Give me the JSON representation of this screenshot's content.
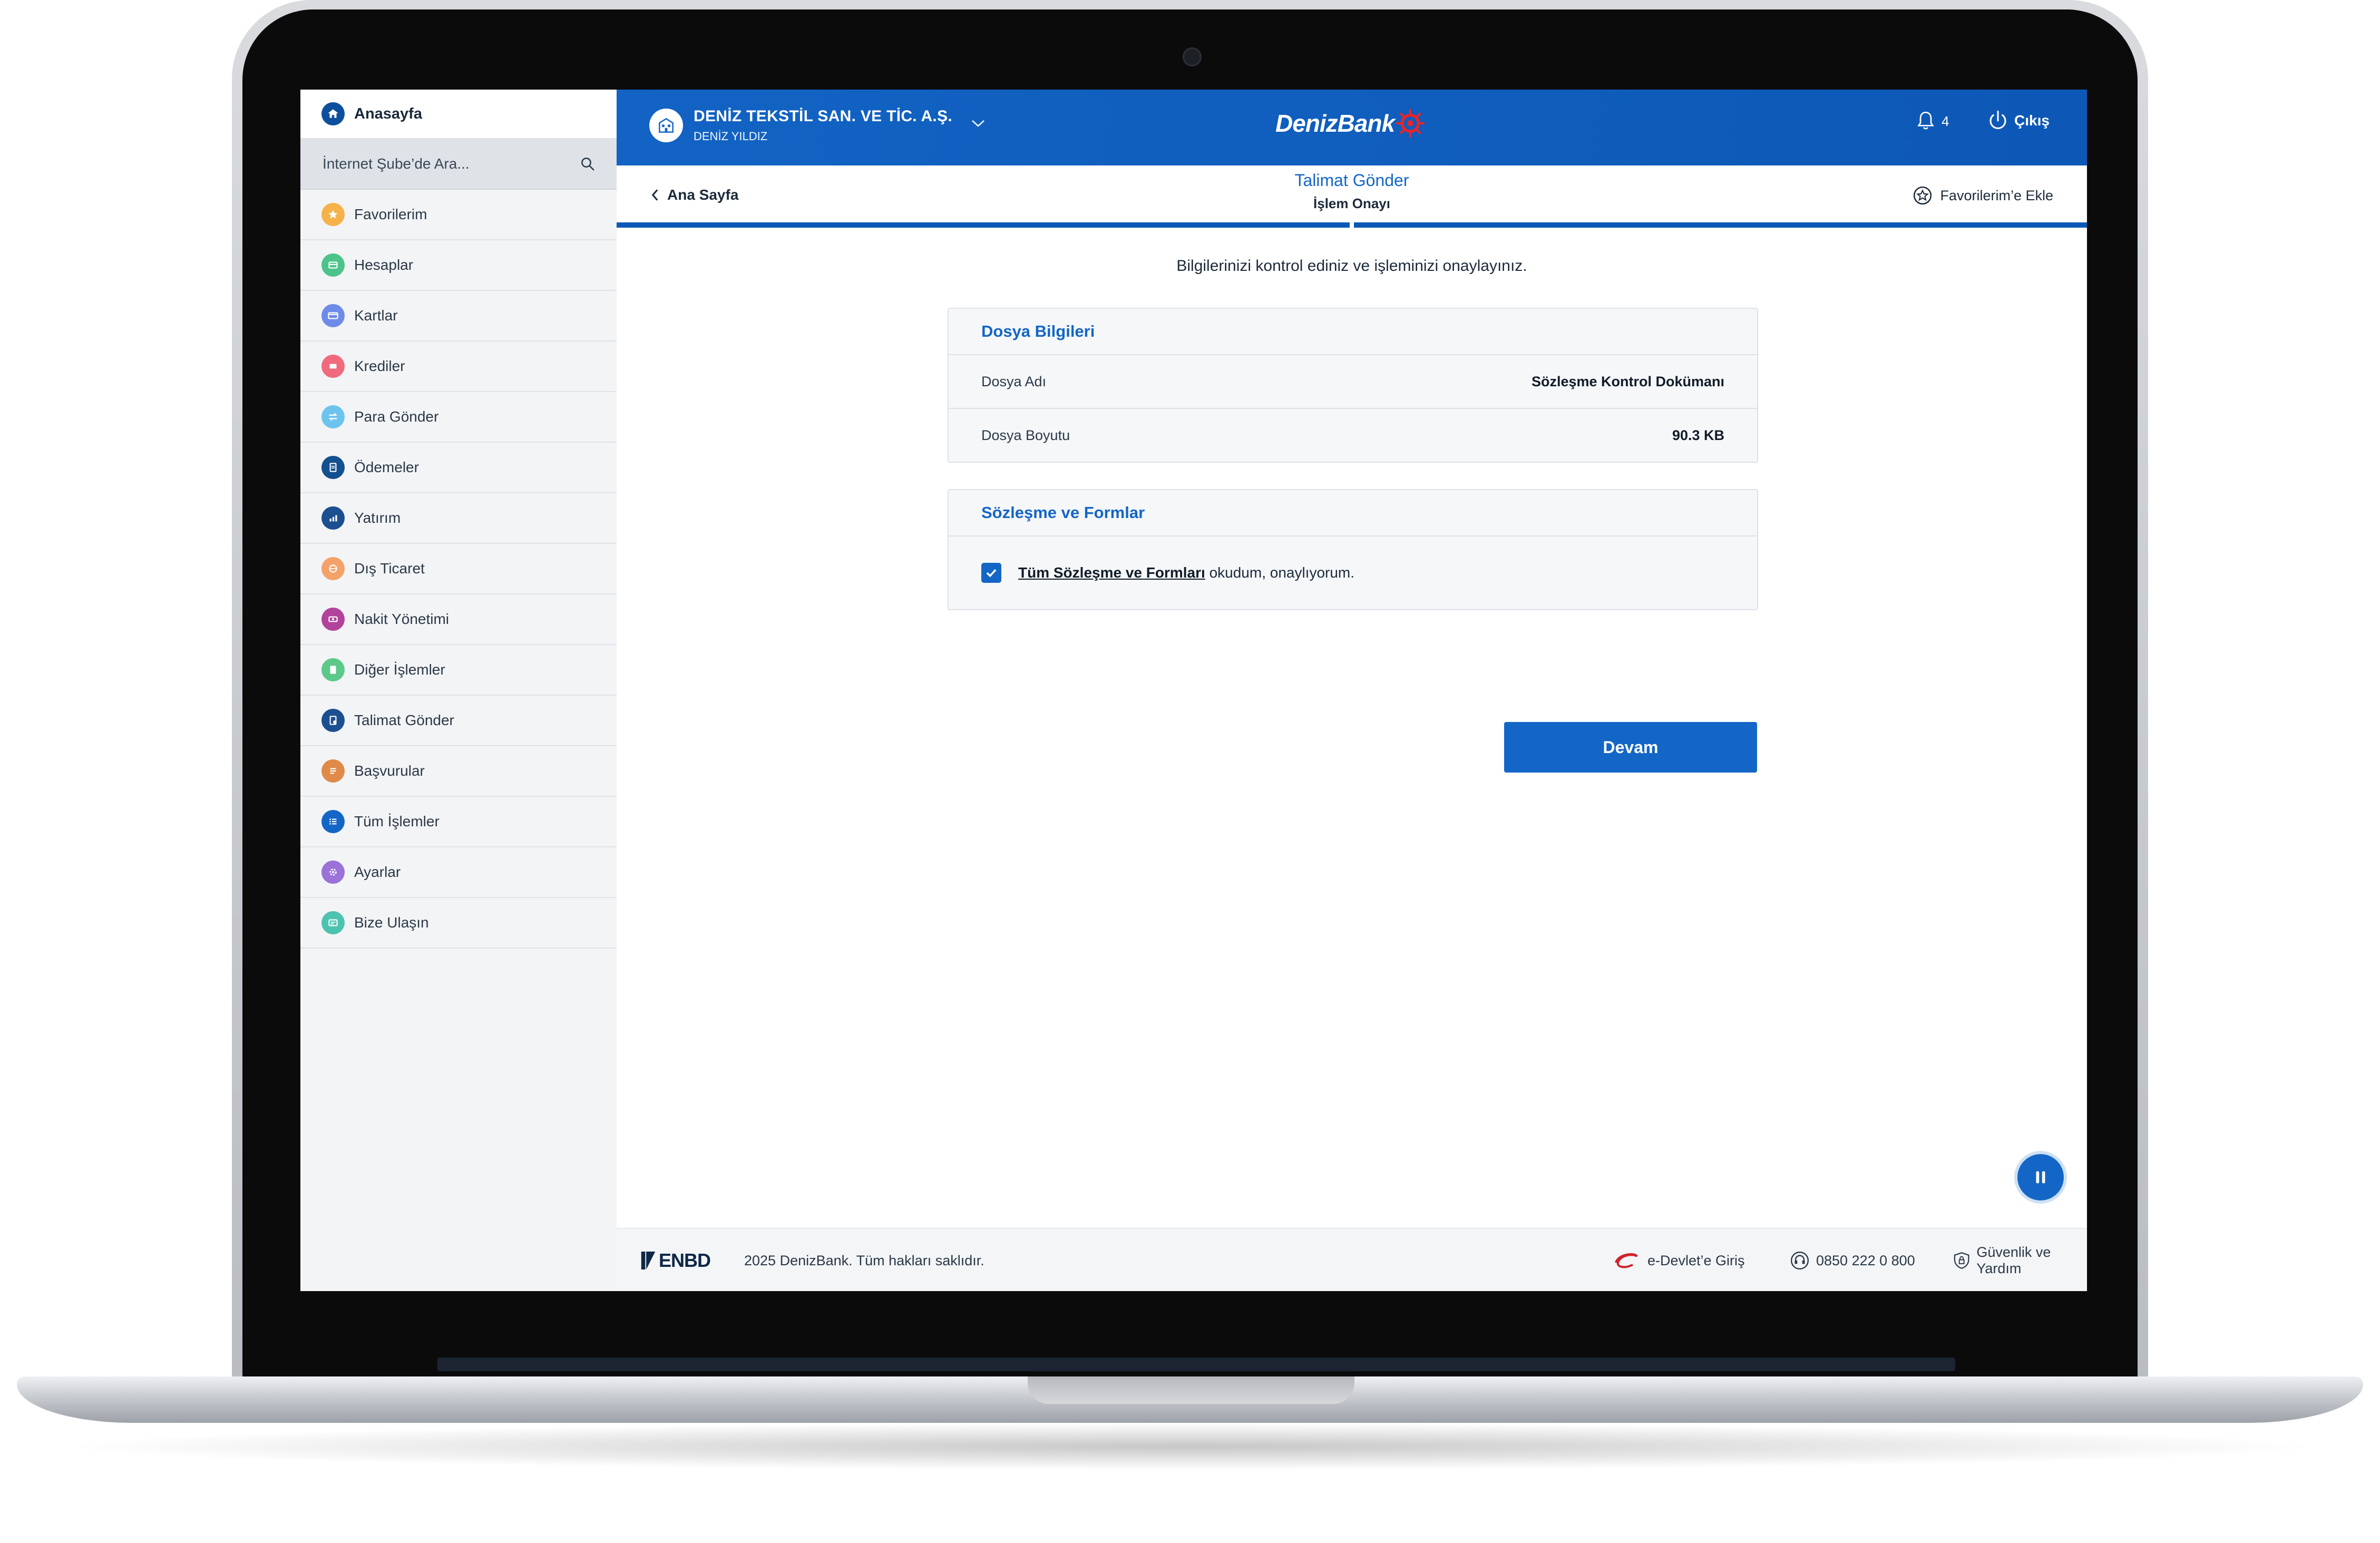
{
  "sidebar": {
    "home_label": "Anasayfa",
    "search_placeholder": "İnternet Şube’de Ara...",
    "items": [
      {
        "label": "Favorilerim",
        "icon": "star-icon",
        "color": "#f6b24a"
      },
      {
        "label": "Hesaplar",
        "icon": "accounts-icon",
        "color": "#4cc38a"
      },
      {
        "label": "Kartlar",
        "icon": "card-icon",
        "color": "#6d8be8"
      },
      {
        "label": "Krediler",
        "icon": "loan-icon",
        "color": "#f06a7e"
      },
      {
        "label": "Para Gönder",
        "icon": "transfer-icon",
        "color": "#6cc4ee"
      },
      {
        "label": "Ödemeler",
        "icon": "payments-icon",
        "color": "#12508f"
      },
      {
        "label": "Yatırım",
        "icon": "investment-icon",
        "color": "#1b4f8f"
      },
      {
        "label": "Dış Ticaret",
        "icon": "trade-icon",
        "color": "#f4a26a"
      },
      {
        "label": "Nakit Yönetimi",
        "icon": "cash-icon",
        "color": "#b2439a"
      },
      {
        "label": "Diğer İşlemler",
        "icon": "other-icon",
        "color": "#5cc98a"
      },
      {
        "label": "Talimat Gönder",
        "icon": "instruction-icon",
        "color": "#1b4f8f"
      },
      {
        "label": "Başvurular",
        "icon": "application-icon",
        "color": "#e08a4a"
      },
      {
        "label": "Tüm İşlemler",
        "icon": "list-icon",
        "color": "#1466c6"
      },
      {
        "label": "Ayarlar",
        "icon": "settings-icon",
        "color": "#9a72d8"
      },
      {
        "label": "Bize Ulaşın",
        "icon": "contact-icon",
        "color": "#4cc3b0"
      }
    ]
  },
  "header": {
    "company_name": "DENİZ TEKSTİL SAN. VE TİC. A.Ş.",
    "user_name": "DENİZ YILDIZ",
    "brand": "DenizBank",
    "notification_count": "4",
    "logout_label": "Çıkış",
    "accent": "#0d58b6"
  },
  "subheader": {
    "back_label": "Ana Sayfa",
    "title": "Talimat Gönder",
    "subtitle": "İşlem Onayı",
    "favorite_label": "Favorilerim’e Ekle",
    "progress": {
      "steps": 2,
      "completed": 2
    }
  },
  "main": {
    "instruction": "Bilgilerinizi kontrol ediniz ve işleminizi onaylayınız.",
    "file_card": {
      "title": "Dosya Bilgileri",
      "rows": [
        {
          "key": "Dosya Adı",
          "value": "Sözleşme Kontrol Dokümanı"
        },
        {
          "key": "Dosya Boyutu",
          "value": "90.3 KB"
        }
      ]
    },
    "contract_card": {
      "title": "Sözleşme ve Formlar",
      "consent_link": "Tüm Sözleşme ve Formları",
      "consent_text": " okudum, onaylıyorum.",
      "checked": true
    },
    "continue_label": "Devam"
  },
  "footer": {
    "logo": "ENBD",
    "copyright": "2025 DenizBank. Tüm hakları saklıdır.",
    "edevlet": "e-Devlet’e Giriş",
    "phone": "0850 222 0 800",
    "security": "Güvenlik ve Yardım"
  }
}
